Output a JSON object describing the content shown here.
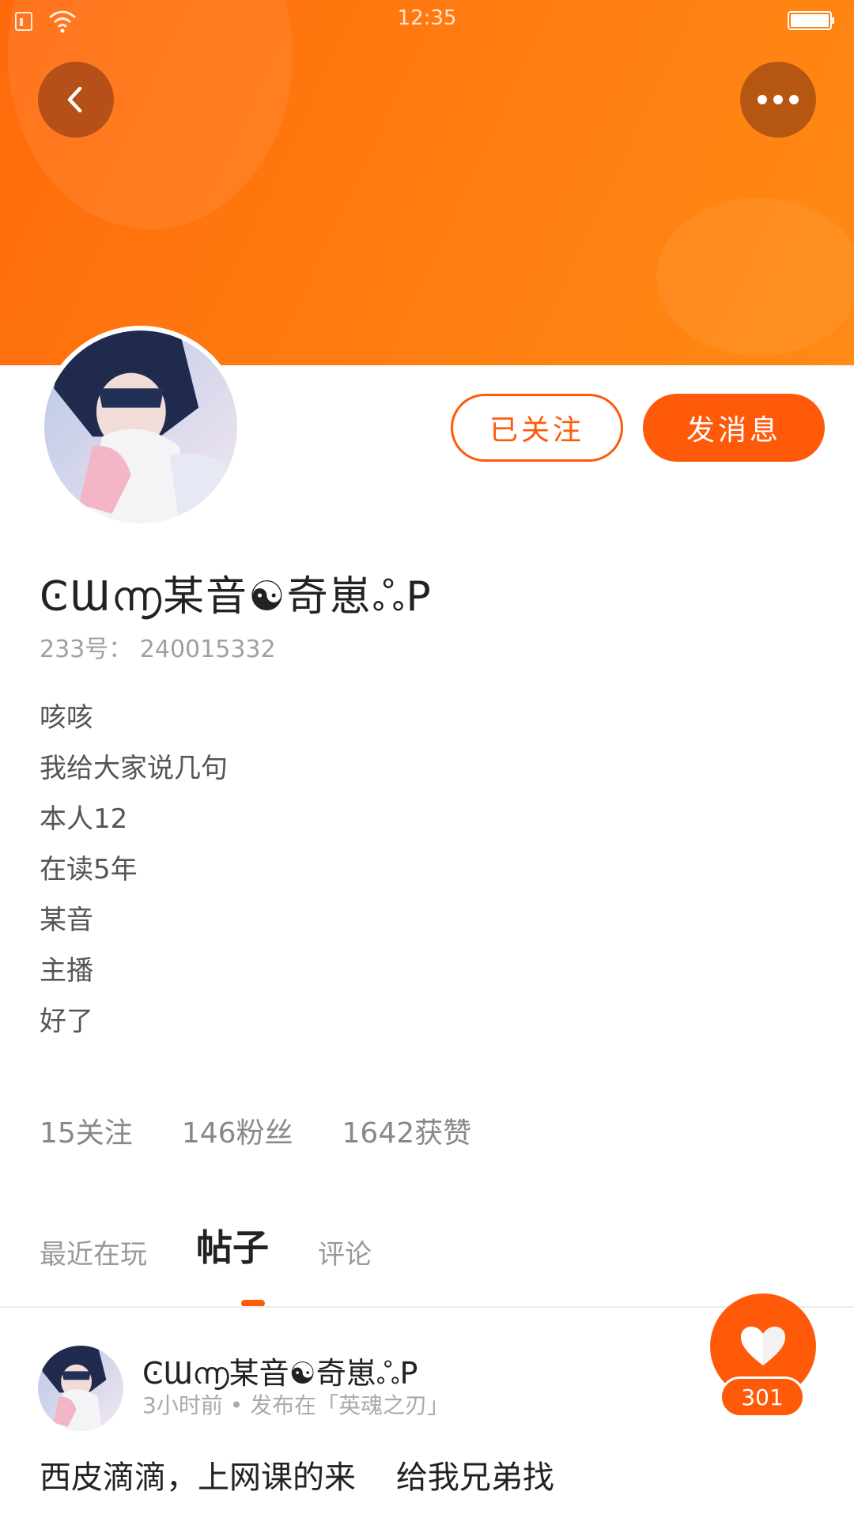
{
  "status_bar": {
    "time": "12:35"
  },
  "colors": {
    "accent": "#ff5a0a",
    "header_gradient_start": "#ff6a0c",
    "header_gradient_end": "#ff8a14"
  },
  "header": {
    "back_icon": "chevron-left-icon",
    "more_icon": "more-horizontal-icon"
  },
  "profile": {
    "username": "ϾƜ൬某音☯奇崽ஃP",
    "id_text": "233号： 240015332",
    "follow_label": "已关注",
    "message_label": "发消息",
    "bio": [
      "咳咳",
      "我给大家说几句",
      "本人12",
      "在读5年",
      "某音",
      "主播",
      "好了"
    ],
    "stats": {
      "following": "15关注",
      "followers": "146粉丝",
      "likes": "1642获赞"
    }
  },
  "tabs": [
    {
      "label": "最近在玩",
      "active": false
    },
    {
      "label": "帖子",
      "active": true
    },
    {
      "label": "评论",
      "active": false
    }
  ],
  "post": {
    "author": "ϾƜ൬某音☯奇崽ஃP",
    "meta": "3小时前 • 发布在「英魂之刃」",
    "text": "西皮滴滴，上网课的来    给我兄弟找",
    "like_count": "301",
    "like_icon": "heart-icon"
  }
}
